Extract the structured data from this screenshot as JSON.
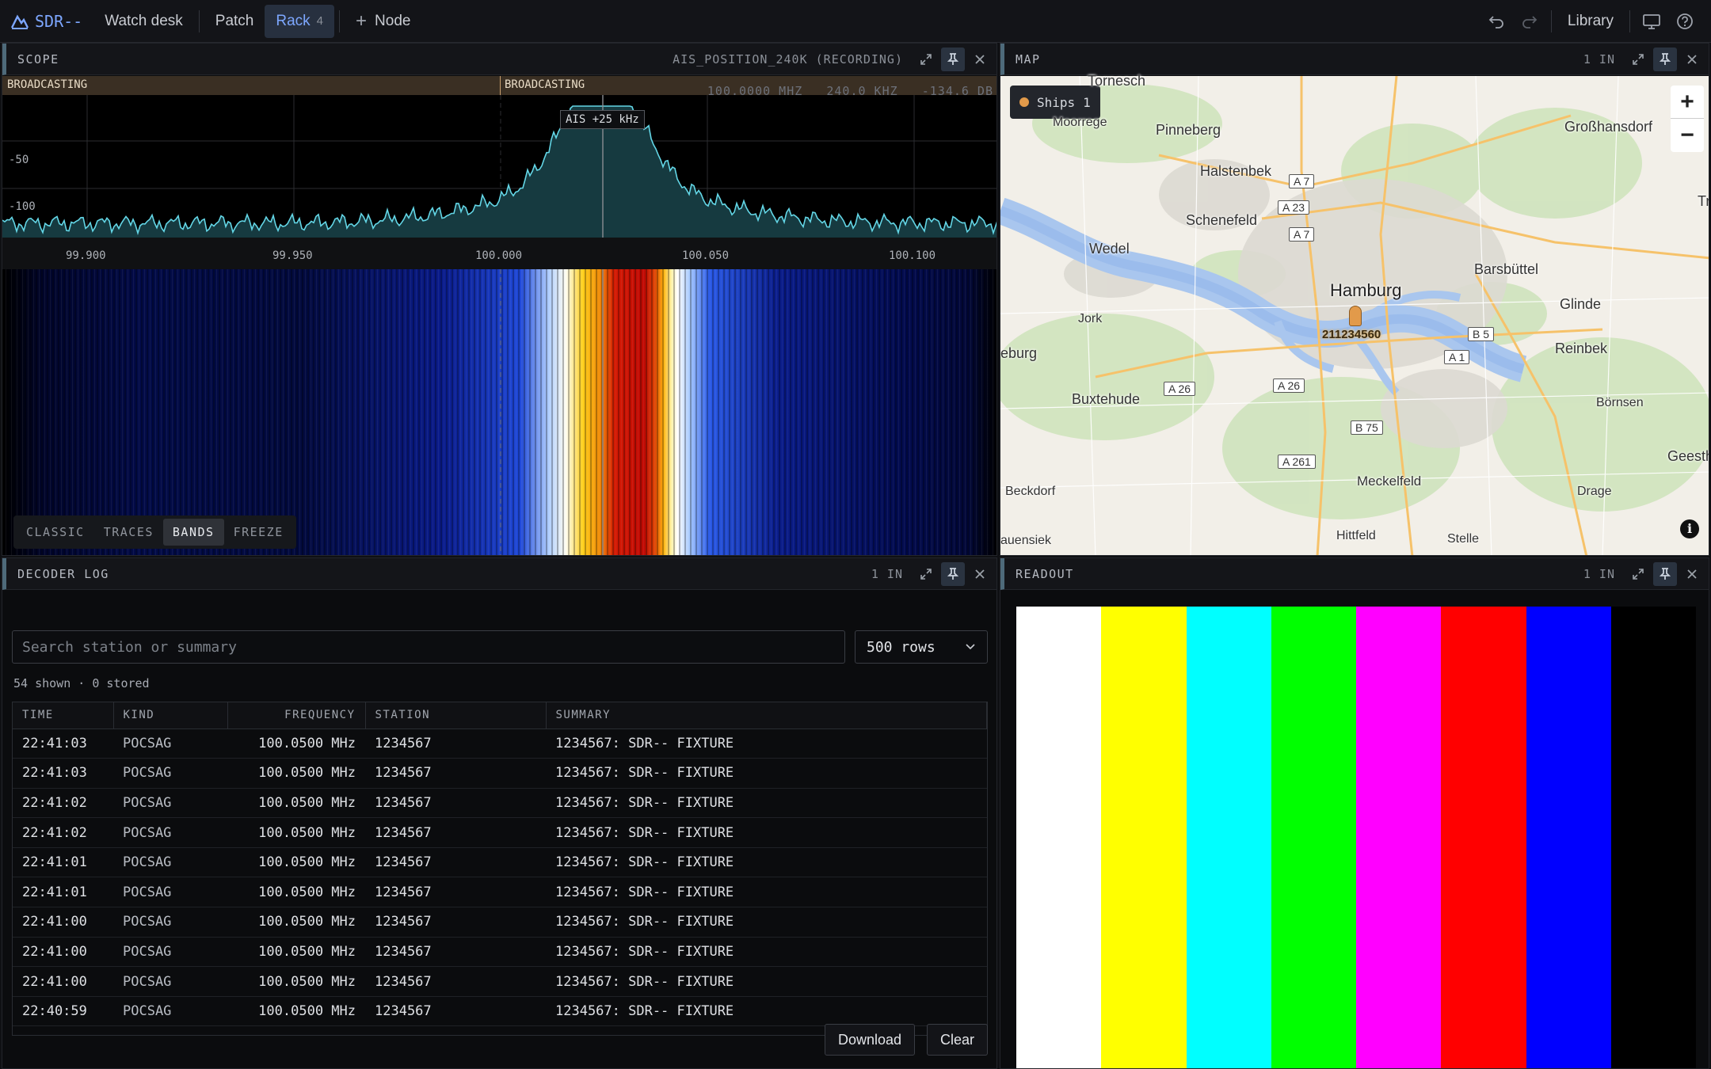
{
  "app": {
    "brand": "SDR--",
    "nav": [
      "Watch desk",
      "Patch",
      "Rack",
      "Node"
    ],
    "rack_count": "4",
    "library": "Library"
  },
  "scope": {
    "title": "SCOPE",
    "source": "AIS_POSITION_240K (RECORDING)",
    "band_left": "BROADCASTING",
    "band_right": "BROADCASTING",
    "readout": "100.0000 MHZ   240.0 KHZ   -134.6 DB",
    "tooltip": "AIS +25 kHz",
    "y_ticks": [
      "-50",
      "-100"
    ],
    "x_ticks": [
      "99.900",
      "99.950",
      "100.000",
      "100.050",
      "100.100"
    ],
    "modes": [
      "CLASSIC",
      "TRACES",
      "BANDS",
      "FREEZE"
    ],
    "active_mode": "BANDS"
  },
  "map": {
    "title": "MAP",
    "inputs": "1 IN",
    "ships_label": "Ships",
    "ships_count": "1",
    "vessel_id": "211234560",
    "towns": [
      "Tornesch",
      "Moorrege",
      "Pinneberg",
      "Großhansdorf",
      "Halstenbek",
      "Schenefeld",
      "Wedel",
      "Hamburg",
      "Barsbüttel",
      "Glinde",
      "Jork",
      "Reinbek",
      "Buxtehude",
      "Börnsen",
      "Geesthacht",
      "Meckelfeld",
      "Beckdorf",
      "Drage",
      "Hittfeld",
      "Stelle",
      "eburg",
      "auensiek",
      "Tr"
    ],
    "roads": [
      "A 7",
      "A 23",
      "A 7",
      "B 5",
      "A 1",
      "A 26",
      "A 26",
      "B 75",
      "A 261"
    ]
  },
  "decoder": {
    "title": "DECODER LOG",
    "inputs": "1 IN",
    "search_placeholder": "Search station or summary",
    "rows_select": "500 rows",
    "summary_line": "54 shown · 0 stored",
    "columns": [
      "TIME",
      "KIND",
      "FREQUENCY",
      "STATION",
      "SUMMARY"
    ],
    "rows": [
      [
        "22:41:03",
        "POCSAG",
        "100.0500 MHz",
        "1234567",
        "1234567: SDR-- FIXTURE"
      ],
      [
        "22:41:03",
        "POCSAG",
        "100.0500 MHz",
        "1234567",
        "1234567: SDR-- FIXTURE"
      ],
      [
        "22:41:02",
        "POCSAG",
        "100.0500 MHz",
        "1234567",
        "1234567: SDR-- FIXTURE"
      ],
      [
        "22:41:02",
        "POCSAG",
        "100.0500 MHz",
        "1234567",
        "1234567: SDR-- FIXTURE"
      ],
      [
        "22:41:01",
        "POCSAG",
        "100.0500 MHz",
        "1234567",
        "1234567: SDR-- FIXTURE"
      ],
      [
        "22:41:01",
        "POCSAG",
        "100.0500 MHz",
        "1234567",
        "1234567: SDR-- FIXTURE"
      ],
      [
        "22:41:00",
        "POCSAG",
        "100.0500 MHz",
        "1234567",
        "1234567: SDR-- FIXTURE"
      ],
      [
        "22:41:00",
        "POCSAG",
        "100.0500 MHz",
        "1234567",
        "1234567: SDR-- FIXTURE"
      ],
      [
        "22:41:00",
        "POCSAG",
        "100.0500 MHz",
        "1234567",
        "1234567: SDR-- FIXTURE"
      ],
      [
        "22:40:59",
        "POCSAG",
        "100.0500 MHz",
        "1234567",
        "1234567: SDR-- FIXTURE"
      ]
    ],
    "download": "Download",
    "clear": "Clear"
  },
  "readout": {
    "title": "READOUT",
    "inputs": "1 IN",
    "bar_colors": [
      "#ffffff",
      "#ffff00",
      "#00ffff",
      "#00ff00",
      "#ff00ff",
      "#ff0000",
      "#0000ff",
      "#000000"
    ]
  },
  "colors": {
    "accent": "#7da7ff",
    "spectrum": "#63d6e6"
  }
}
